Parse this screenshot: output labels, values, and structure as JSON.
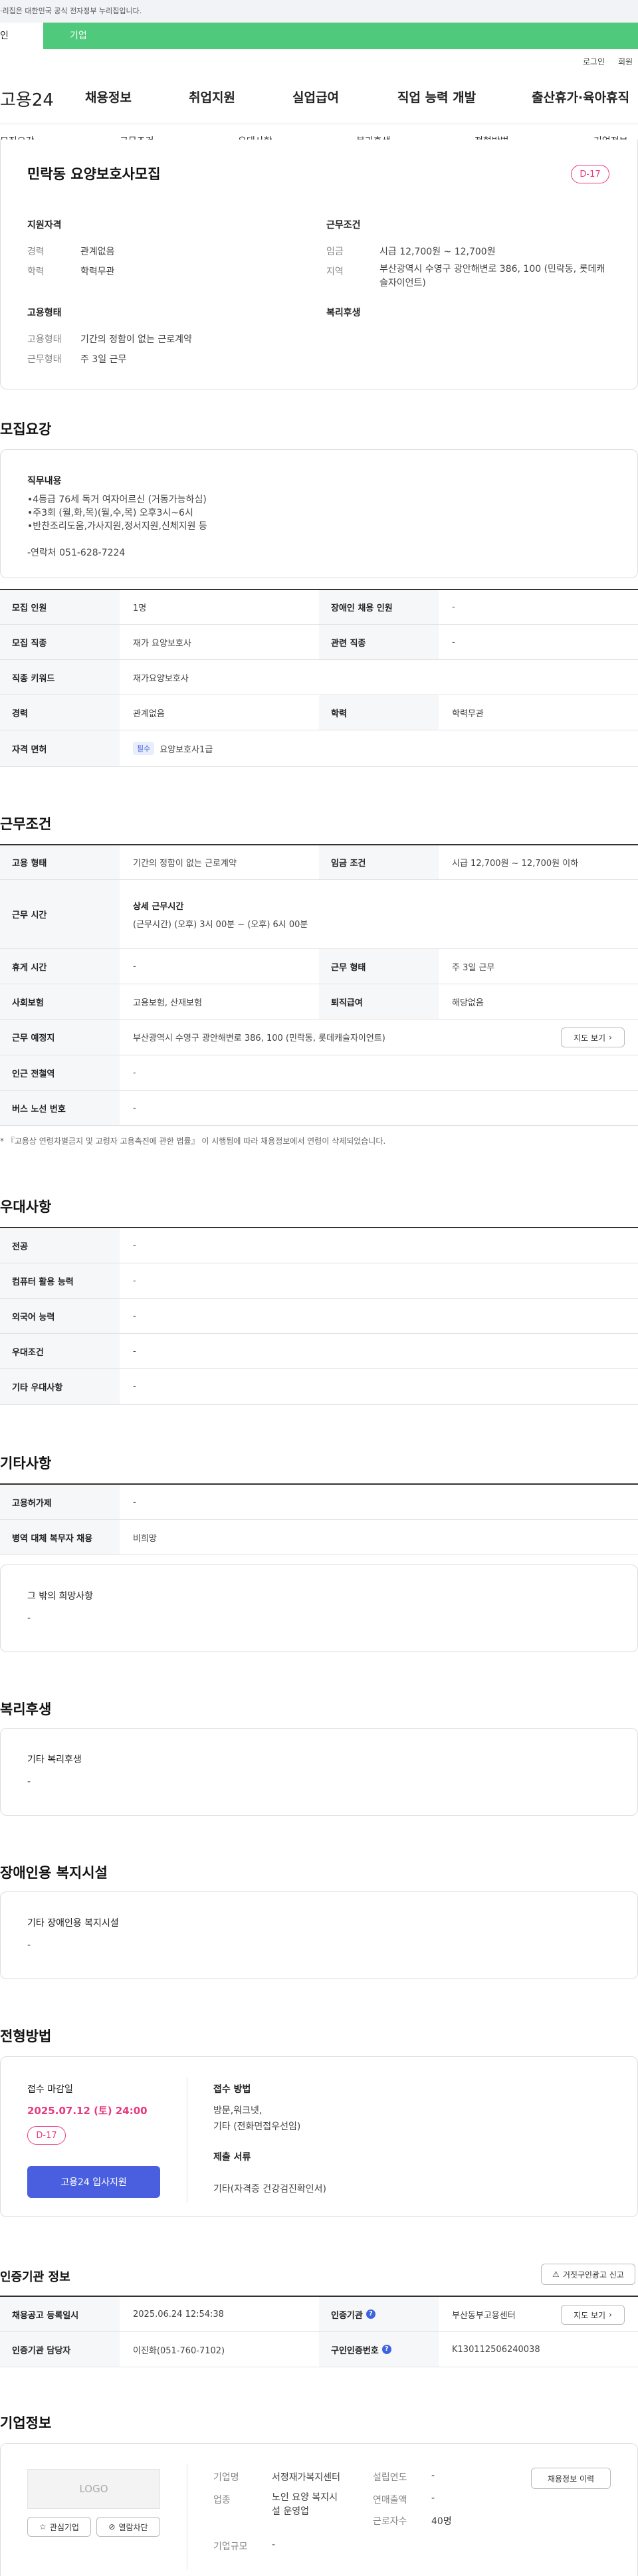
{
  "gov_banner": "·리집은 대한민국 공식 전자정부 누리집입니다.",
  "tabs": {
    "individual": "인",
    "company": "기업"
  },
  "util": {
    "login": "로그인",
    "join": "회원"
  },
  "logo": "고용24",
  "gnb": [
    "채용정보",
    "취업지원",
    "실업급여",
    "직업 능력 개발",
    "출산휴가·육아휴직"
  ],
  "snb": [
    "모집요강",
    "근무조건",
    "우대사항",
    "복리후생",
    "전형방법",
    "기업정보"
  ],
  "summary": {
    "title": "민락동 요양보호사모집",
    "dday": "D-17",
    "qual_title": "지원자격",
    "cond_title": "근무조건",
    "emp_title": "고용형태",
    "welfare_title": "복리후생",
    "career_label": "경력",
    "career_value": "관계없음",
    "edu_label": "학력",
    "edu_value": "학력무관",
    "wage_label": "임금",
    "wage_value": "시급 12,700원 ~ 12,700원",
    "region_label": "지역",
    "region_value": "부산광역시 수영구 광안해변로 386, 100 (민락동, 롯데캐슬자이언트)",
    "emptype_label": "고용형태",
    "emptype_value": "기간의 정함이 없는 근로계약",
    "workform_label": "근무형태",
    "workform_value": "주 3일 근무"
  },
  "recruit": {
    "title": "모집요강",
    "duty_title": "직무내용",
    "duty_lines": [
      "•4등급 76세 독거 여자어르신 (거동가능하심)",
      "•주3회 (월,화,목)(월,수,목) 오후3시~6시",
      "•반찬조리도움,가사지원,정서지원,신체지원 등",
      "",
      "-연락처 051-628-7224"
    ],
    "rows": [
      {
        "h1": "모집 인원",
        "v1": "1명",
        "h2": "장애인 채용 인원",
        "v2": "-"
      },
      {
        "h1": "모집 직종",
        "v1": "재가 요양보호사",
        "h2": "관련 직종",
        "v2": "-"
      },
      {
        "h1": "직종 키워드",
        "v1": "재가요양보호사"
      },
      {
        "h1": "경력",
        "v1": "관계없음",
        "h2": "학력",
        "v2": "학력무관"
      },
      {
        "h1": "자격 면허",
        "pill": "필수",
        "v1": "요양보호사1급"
      }
    ]
  },
  "work": {
    "title": "근무조건",
    "emptype_h": "고용 형태",
    "emptype_v": "기간의 정함이 없는 근로계약",
    "wage_h": "임금 조건",
    "wage_v": "시급 12,700원 ~ 12,700원 이하",
    "time_h": "근무 시간",
    "time_detail_title": "상세 근무시간",
    "time_detail": "(근무시간) (오후) 3시 00분 ~ (오후) 6시 00분",
    "holiday_h": "휴게 시간",
    "holiday_v": "-",
    "form_h": "근무 형태",
    "form_v": "주 3일 근무",
    "insurance_h": "사회보험",
    "insurance_v": "고용보험, 산재보험",
    "severance_h": "퇴직급여",
    "severance_v": "해당없음",
    "place_h": "근무 예정지",
    "place_v": "부산광역시 수영구 광안해변로 386, 100 (민락동, 롯데캐슬자이언트)",
    "map_btn": "지도 보기",
    "station_h": "인근 전철역",
    "station_v": "-",
    "bus_h": "버스 노선 번호",
    "bus_v": "-",
    "note": "* 『고용상 연령차별금지 및 고령자 고용촉진에 관한 법률』 이 시행됨에 따라 채용정보에서 연령이 삭제되었습니다."
  },
  "pref": {
    "title": "우대사항",
    "rows": [
      {
        "h": "전공",
        "v": "-"
      },
      {
        "h": "컴퓨터 활용 능력",
        "v": "-"
      },
      {
        "h": "외국어 능력",
        "v": "-"
      },
      {
        "h": "우대조건",
        "v": "-"
      },
      {
        "h": "기타 우대사항",
        "v": "-"
      }
    ]
  },
  "etc": {
    "title": "기타사항",
    "rows": [
      {
        "h": "고용허가제",
        "v": "-"
      },
      {
        "h": "병역 대체 복무자 채용",
        "v": "비희망"
      }
    ],
    "box_title": "그 밖의 희망사항",
    "box_value": "-"
  },
  "welfare": {
    "title": "복리후생",
    "box_title": "기타 복리후생",
    "box_value": "-"
  },
  "disabled": {
    "title": "장애인용 복지시설",
    "box_title": "기타 장애인용 복지시설",
    "box_value": "-"
  },
  "selection": {
    "title": "전형방법",
    "deadline_label": "접수 마감일",
    "deadline": "2025.07.12 (토) 24:00",
    "dday": "D-17",
    "apply_btn": "고용24 입사지원",
    "method_title": "접수 방법",
    "method_lines": [
      "방문,워크넷,",
      "기타 (전화면접우선임)"
    ],
    "docs_title": "제출 서류",
    "docs": "기타(자격증 건강검진확인서)"
  },
  "cert": {
    "title": "인증기관 정보",
    "report_btn": "거짓구인광고 신고",
    "reg_h": "채용공고 등록일시",
    "reg_v": "2025.06.24 12:54:38",
    "org_h": "인증기관",
    "org_v": "부산동부고용센터",
    "map_btn": "지도 보기",
    "manager_h": "인증기관 담당자",
    "manager_v": "이진화(051-760-7102)",
    "certno_h": "구인인증번호",
    "certno_v": "K130112506240038"
  },
  "company": {
    "title": "기업정보",
    "logo_text": "LOGO",
    "fav_btn": "관심기업",
    "block_btn": "열람차단",
    "name_h": "기업명",
    "name_v": "서정재가복지센터",
    "year_h": "설립연도",
    "year_v": "-",
    "industry_h": "업종",
    "industry_v": "노인 요양 복지시설 운영업",
    "sales_h": "연매출액",
    "sales_v": "-",
    "staff_h": "근로자수",
    "staff_v": "40명",
    "size_h": "기업규모",
    "size_v": "-",
    "history_btn": "채용정보 이력"
  }
}
